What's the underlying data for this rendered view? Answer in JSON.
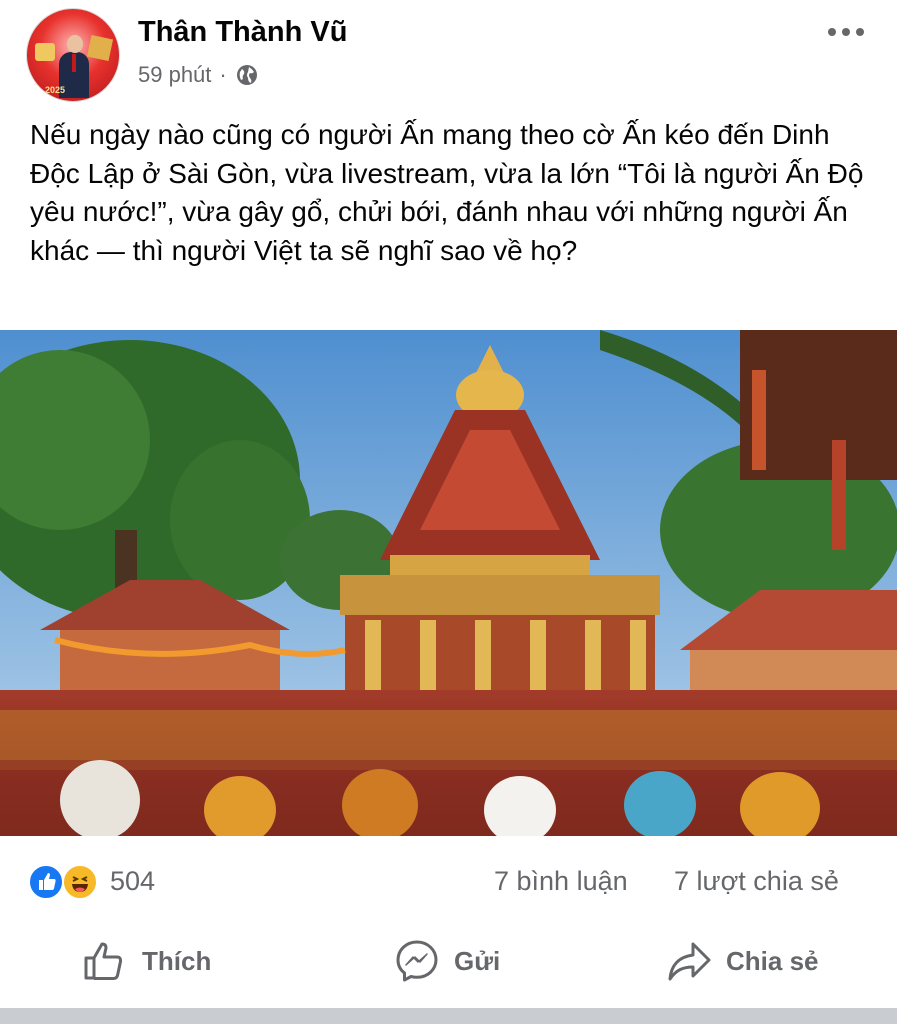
{
  "post": {
    "author": "Thân Thành Vũ",
    "time": "59 phút",
    "separator": "·",
    "privacy_icon": "globe-icon",
    "more_icon": "more-options-icon",
    "avatar_text": "2025",
    "text": "Nếu ngày nào cũng có người Ấn mang theo cờ Ấn kéo đến Dinh Độc Lập ở Sài Gòn, vừa livestream, vừa la lớn “Tôi là người Ấn Độ yêu nước!”, vừa gây gổ, chửi bới, đánh nhau với những người Ấn khác — thì người Việt ta sẽ nghĩ sao về họ?"
  },
  "stats": {
    "reaction_icons": [
      "like-icon",
      "haha-icon"
    ],
    "reaction_count": "504",
    "comments": "7 bình luận",
    "shares": "7 lượt chia sẻ"
  },
  "actions": {
    "like": "Thích",
    "send": "Gửi",
    "share": "Chia sẻ"
  },
  "colors": {
    "text": "#050505",
    "secondary": "#65676b",
    "like_blue": "#1877f2",
    "haha_yellow": "#f7b928",
    "divider": "#c9ccd1"
  }
}
